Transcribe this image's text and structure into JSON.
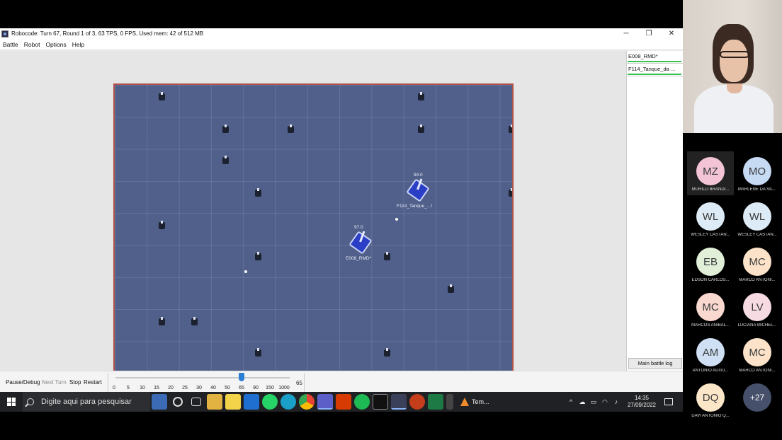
{
  "window": {
    "title": "Robocode: Turn 67, Round 1 of 3, 63 TPS, 0 FPS, Used mem: 42 of 512 MB",
    "minimize": "─",
    "maximize": "❐",
    "close": "✕"
  },
  "menu": [
    "Battle",
    "Robot",
    "Options",
    "Help"
  ],
  "robots": [
    {
      "name": "E008_RMD*",
      "energy": "97.0"
    },
    {
      "name": "F114_Tanque_...!",
      "energy": "94.0"
    }
  ],
  "side_panel": {
    "robot_buttons": [
      "E008_RMD*",
      "F114_Tanque_da ..."
    ],
    "battle_log": "Main battle log"
  },
  "controls": {
    "pause": "Pause/Debug",
    "next_turn": "Next Turn",
    "stop": "Stop",
    "restart": "Restart",
    "tps_ticks": [
      "0",
      "5",
      "10",
      "15",
      "20",
      "25",
      "30",
      "40",
      "50",
      "65",
      "90",
      "150",
      "1000"
    ],
    "tps_value": "65",
    "tps_selected_index": 9
  },
  "taskbar": {
    "search_placeholder": "Digite aqui para pesquisar",
    "tempo_label": "Tem...",
    "time": "14:35",
    "date": "27/09/2022"
  },
  "participants": [
    {
      "initials": "MZ",
      "name": "MURILO BRANDI...",
      "color": "#f2c4d6"
    },
    {
      "initials": "MO",
      "name": "MARLENE DA SIL...",
      "color": "#c6daf4"
    },
    {
      "initials": "WL",
      "name": "WESLEY CASTAN...",
      "color": "#dcebf5"
    },
    {
      "initials": "WL",
      "name": "WESLEY CASTAN...",
      "color": "#dcebf5"
    },
    {
      "initials": "EB",
      "name": "EDSON CARLOS...",
      "color": "#e1efd8"
    },
    {
      "initials": "MC",
      "name": "MARCO ANTONI...",
      "color": "#fbe2c8"
    },
    {
      "initials": "MC",
      "name": "MARCOS ANIBAL...",
      "color": "#f8d8cf"
    },
    {
      "initials": "LV",
      "name": "LUCIANA MICHEL...",
      "color": "#f6dbe2"
    },
    {
      "initials": "AM",
      "name": "ANTONIO AUGU...",
      "color": "#cfe0f4"
    },
    {
      "initials": "MC",
      "name": "MARCO ANTONI...",
      "color": "#fbe2c8"
    },
    {
      "initials": "DQ",
      "name": "DAVI ANTONIO Q...",
      "color": "#fbe6c8"
    },
    {
      "initials": "+27",
      "name": "",
      "color": "#46506a"
    }
  ]
}
